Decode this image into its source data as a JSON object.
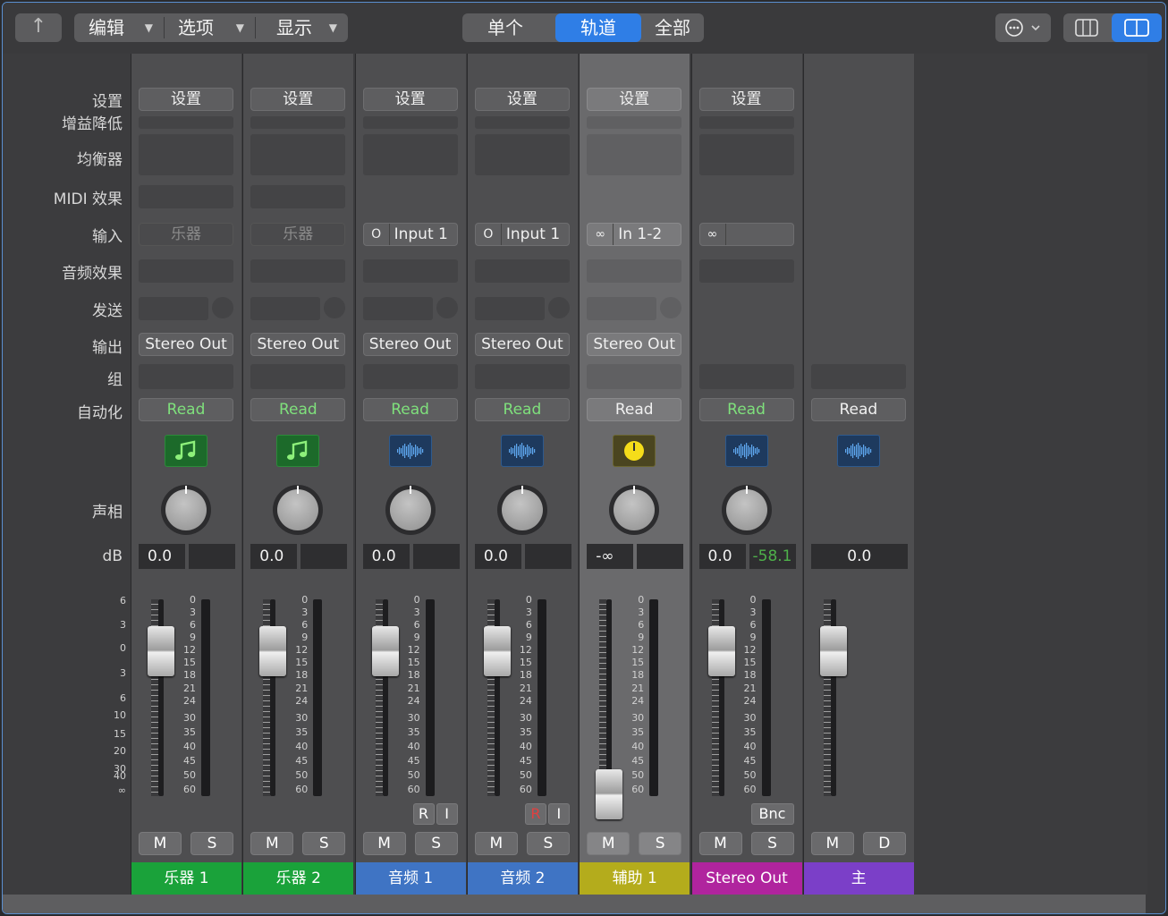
{
  "toolbar": {
    "menus": [
      {
        "label": "编辑"
      },
      {
        "label": "选项"
      },
      {
        "label": "显示"
      }
    ],
    "segments": [
      {
        "label": "单个",
        "active": false
      },
      {
        "label": "轨道",
        "active": true
      },
      {
        "label": "全部",
        "active": false
      }
    ],
    "accent_color": "#2f7ee6"
  },
  "row_labels": {
    "setting": "设置",
    "gain_reduction": "增益降低",
    "eq": "均衡器",
    "midi_fx": "MIDI 效果",
    "input": "输入",
    "audio_fx": "音频效果",
    "send": "发送",
    "output": "输出",
    "group": "组",
    "automation": "自动化",
    "pan": "声相",
    "db": "dB"
  },
  "left_scale": [
    "6",
    "3",
    "0",
    "3",
    "6",
    "10",
    "15",
    "20",
    "30",
    "40",
    "∞"
  ],
  "meter_scale": [
    "0",
    "3",
    "6",
    "9",
    "12",
    "15",
    "18",
    "21",
    "24",
    "30",
    "35",
    "40",
    "45",
    "50",
    "60"
  ],
  "strips": [
    {
      "name": "乐器 1",
      "color": "#1aa23a",
      "setting": "设置",
      "input": "乐器",
      "input_dim": true,
      "output": "Stereo Out",
      "automation": "Read",
      "automation_green": true,
      "icon": "music-note-icon",
      "volume": "0.0",
      "peak": "",
      "buttons": [
        "M",
        "S"
      ],
      "extra": []
    },
    {
      "name": "乐器 2",
      "color": "#1aa23a",
      "setting": "设置",
      "input": "乐器",
      "input_dim": true,
      "output": "Stereo Out",
      "automation": "Read",
      "automation_green": true,
      "icon": "music-note-icon",
      "volume": "0.0",
      "peak": "",
      "buttons": [
        "M",
        "S"
      ],
      "extra": []
    },
    {
      "name": "音频 1",
      "color": "#3f74c4",
      "setting": "设置",
      "input": "Input 1",
      "input_prefix": "O",
      "output": "Stereo Out",
      "automation": "Read",
      "automation_green": true,
      "icon": "waveform-icon",
      "volume": "0.0",
      "peak": "",
      "buttons": [
        "M",
        "S"
      ],
      "extra": [
        "R",
        "I"
      ]
    },
    {
      "name": "音频 2",
      "color": "#3f74c4",
      "setting": "设置",
      "input": "Input 1",
      "input_prefix": "O",
      "output": "Stereo Out",
      "automation": "Read",
      "automation_green": true,
      "icon": "waveform-icon",
      "volume": "0.0",
      "peak": "",
      "buttons": [
        "M",
        "S"
      ],
      "extra": [
        "R",
        "I"
      ]
    },
    {
      "name": "辅助 1",
      "color": "#b4ac1c",
      "setting": "设置",
      "input": "In 1-2",
      "input_prefix": "∞",
      "output": "Stereo Out",
      "automation": "Read",
      "automation_green": false,
      "icon": "knob-yellow-icon",
      "volume": "-∞",
      "peak": "",
      "buttons": [
        "M",
        "S"
      ],
      "extra": []
    },
    {
      "name": "Stereo Out",
      "color": "#b0249e",
      "setting": "设置",
      "input": "",
      "input_prefix": "∞",
      "output": "",
      "automation": "Read",
      "automation_green": true,
      "icon": "waveform-icon",
      "volume": "0.0",
      "peak": "-58.1",
      "buttons": [
        "M",
        "S"
      ],
      "extra": [
        "Bnc"
      ]
    },
    {
      "name": "主",
      "color": "#7b3fc8",
      "setting": "",
      "input": "",
      "output": "",
      "automation": "Read",
      "automation_green": false,
      "icon": "waveform-icon",
      "volume": "0.0",
      "peak": "",
      "buttons": [
        "M",
        "D"
      ],
      "extra": []
    }
  ]
}
